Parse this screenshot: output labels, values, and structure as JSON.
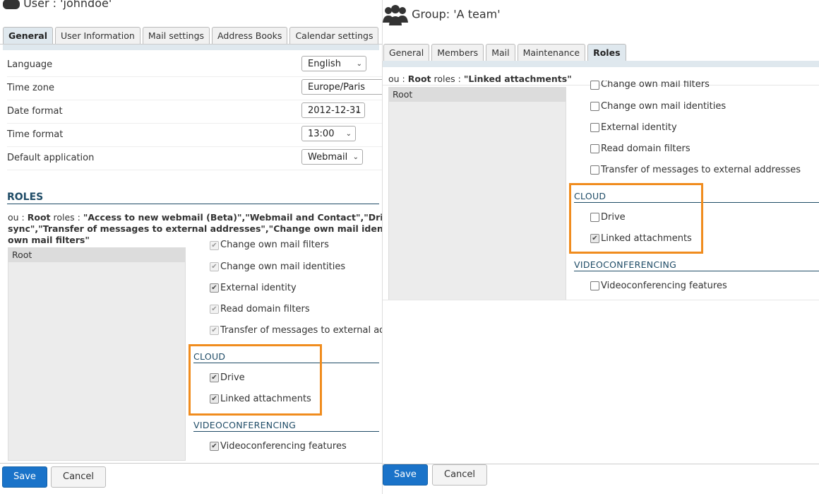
{
  "user_panel": {
    "title": "User : 'johndoe'",
    "tabs": [
      {
        "label": "General",
        "active": true
      },
      {
        "label": "User Information",
        "active": false
      },
      {
        "label": "Mail settings",
        "active": false
      },
      {
        "label": "Address Books",
        "active": false
      },
      {
        "label": "Calendar settings",
        "active": false
      }
    ],
    "settings": [
      {
        "label": "Language",
        "value": "English"
      },
      {
        "label": "Time zone",
        "value": "Europe/Paris"
      },
      {
        "label": "Date format",
        "value": "2012-12-31"
      },
      {
        "label": "Time format",
        "value": "13:00"
      },
      {
        "label": "Default application",
        "value": "Webmail"
      }
    ],
    "roles_heading": "ROLES",
    "roles_desc": {
      "prefix": "ou : ",
      "ou": "Root",
      "mid": " roles : ",
      "line1": "\"Access to new webmail (Beta)\",\"Webmail and Contact\",\"Drive\",\"Vide",
      "line2": "sync\",\"Transfer of messages to external addresses\",\"Change own mail identities\",\"Ac",
      "line3": "own mail filters\""
    },
    "tree_root": "Root",
    "roles": {
      "cut_off_item": "Change own mail filters",
      "items": [
        {
          "label": "Change own mail identities",
          "checked": true
        },
        {
          "label": "External identity",
          "checked": true
        },
        {
          "label": "Read domain filters",
          "checked": true
        },
        {
          "label": "Transfer of messages to external addre",
          "checked": true
        }
      ],
      "cloud_heading": "CLOUD",
      "cloud_items": [
        {
          "label": "Drive",
          "checked": true
        },
        {
          "label": "Linked attachments",
          "checked": true
        }
      ],
      "video_heading": "VIDEOCONFERENCING",
      "video_items": [
        {
          "label": "Videoconferencing features",
          "checked": true
        }
      ]
    },
    "save_label": "Save",
    "cancel_label": "Cancel"
  },
  "group_panel": {
    "title": "Group: 'A team'",
    "tabs": [
      {
        "label": "General",
        "active": false
      },
      {
        "label": "Members",
        "active": false
      },
      {
        "label": "Mail",
        "active": false
      },
      {
        "label": "Maintenance",
        "active": false
      },
      {
        "label": "Roles",
        "active": true
      }
    ],
    "roles_desc": {
      "prefix": "ou : ",
      "ou": "Root",
      "mid": " roles : ",
      "line1": "\"Linked attachments\""
    },
    "tree_root": "Root",
    "roles": {
      "cut_off_item": "Change own mail filters",
      "items": [
        {
          "label": "Change own mail identities",
          "checked": false
        },
        {
          "label": "External identity",
          "checked": false
        },
        {
          "label": "Read domain filters",
          "checked": false
        },
        {
          "label": "Transfer of messages to external addresses",
          "checked": false
        }
      ],
      "cloud_heading": "CLOUD",
      "cloud_items": [
        {
          "label": "Drive",
          "checked": false
        },
        {
          "label": "Linked attachments",
          "checked": true
        }
      ],
      "video_heading": "VIDEOCONFERENCING",
      "video_items": [
        {
          "label": "Videoconferencing features",
          "checked": false
        }
      ]
    },
    "save_label": "Save",
    "cancel_label": "Cancel"
  },
  "colors": {
    "accent": "#1e4b66",
    "highlight": "#f08c1e",
    "save_button": "#1a73c9"
  }
}
